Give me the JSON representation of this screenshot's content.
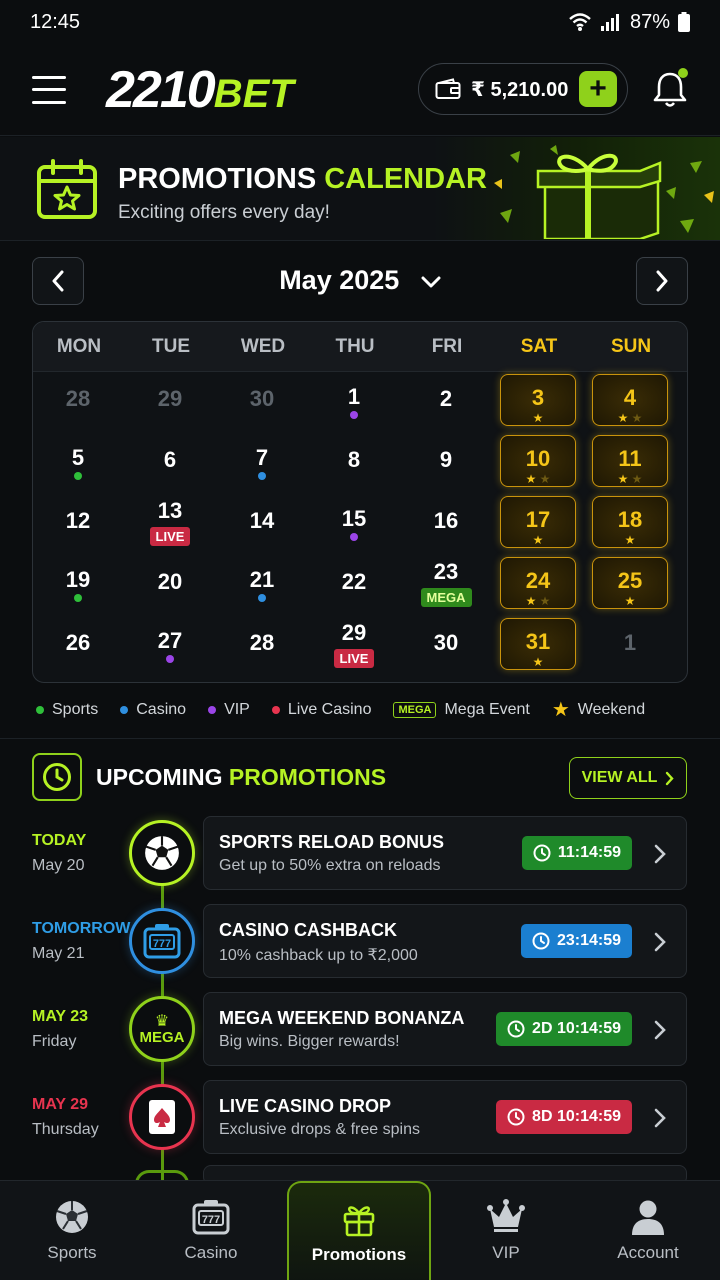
{
  "status": {
    "time": "12:45",
    "battery": "87%"
  },
  "header": {
    "logo_num": "2210",
    "logo_bet": "BET",
    "balance": "₹ 5,210.00",
    "add": "+"
  },
  "banner": {
    "title_white": "PROMOTIONS ",
    "title_green": "CALENDAR",
    "subtitle": "Exciting offers every day!"
  },
  "calendar": {
    "month": "May 2025",
    "weekdays": [
      "MON",
      "TUE",
      "WED",
      "THU",
      "FRI",
      "SAT",
      "SUN"
    ],
    "days": [
      {
        "n": "28",
        "muted": true
      },
      {
        "n": "29",
        "muted": true
      },
      {
        "n": "30",
        "muted": true
      },
      {
        "n": "1",
        "dot": "vip"
      },
      {
        "n": "2"
      },
      {
        "n": "3",
        "wk": true,
        "stars": 1
      },
      {
        "n": "4",
        "wk": true,
        "stars": 2
      },
      {
        "n": "5",
        "dot": "sports"
      },
      {
        "n": "6"
      },
      {
        "n": "7",
        "dot": "casino"
      },
      {
        "n": "8"
      },
      {
        "n": "9"
      },
      {
        "n": "10",
        "wk": true,
        "stars": 2
      },
      {
        "n": "11",
        "wk": true,
        "stars": 2
      },
      {
        "n": "12"
      },
      {
        "n": "13",
        "tag": "LIVE"
      },
      {
        "n": "14"
      },
      {
        "n": "15",
        "dot": "vip"
      },
      {
        "n": "16"
      },
      {
        "n": "17",
        "wk": true,
        "stars": 1
      },
      {
        "n": "18",
        "wk": true,
        "stars": 1
      },
      {
        "n": "19",
        "dot": "sports"
      },
      {
        "n": "20"
      },
      {
        "n": "21",
        "dot": "casino"
      },
      {
        "n": "22"
      },
      {
        "n": "23",
        "tag": "MEGA"
      },
      {
        "n": "24",
        "wk": true,
        "stars": 2
      },
      {
        "n": "25",
        "wk": true,
        "stars": 1
      },
      {
        "n": "26"
      },
      {
        "n": "27",
        "dot": "vip"
      },
      {
        "n": "28"
      },
      {
        "n": "29",
        "tag": "LIVE"
      },
      {
        "n": "30"
      },
      {
        "n": "31",
        "wk": true,
        "stars": 1
      },
      {
        "n": "1",
        "muted": true
      }
    ]
  },
  "colors": {
    "sports": "#2fbf3a",
    "casino": "#2f8fe0",
    "vip": "#9b45e8",
    "live": "#e8344f",
    "accent": "#b6f224",
    "gold": "#f5c518"
  },
  "legend": {
    "sports": "Sports",
    "casino": "Casino",
    "vip": "VIP",
    "live": "Live Casino",
    "mega_tag": "MEGA",
    "mega": "Mega Event",
    "weekend": "Weekend"
  },
  "upcoming": {
    "title_white": "UPCOMING ",
    "title_green": "PROMOTIONS",
    "view_all": "VIEW ALL",
    "items": [
      {
        "when": "TODAY",
        "sub": "May 20",
        "title": "SPORTS RELOAD BONUS",
        "desc": "Get up to 50% extra on reloads",
        "timer": "11:14:59",
        "kind": "sports-icon"
      },
      {
        "when": "TOMORROW",
        "sub": "May 21",
        "title": "CASINO CASHBACK",
        "desc": "10% cashback up to ₹2,000",
        "timer": "23:14:59",
        "kind": "slot-icon"
      },
      {
        "when": "MAY 23",
        "sub": "Friday",
        "title": "MEGA WEEKEND BONANZA",
        "desc": "Big wins. Bigger rewards!",
        "timer": "2D 10:14:59",
        "kind": "mega-icon",
        "badge": "MEGA"
      },
      {
        "when": "MAY 29",
        "sub": "Thursday",
        "title": "LIVE CASINO DROP",
        "desc": "Exclusive drops & free spins",
        "timer": "8D 10:14:59",
        "kind": "card-icon"
      }
    ]
  },
  "bottom_nav": [
    "Sports",
    "Casino",
    "Promotions",
    "VIP",
    "Account"
  ]
}
